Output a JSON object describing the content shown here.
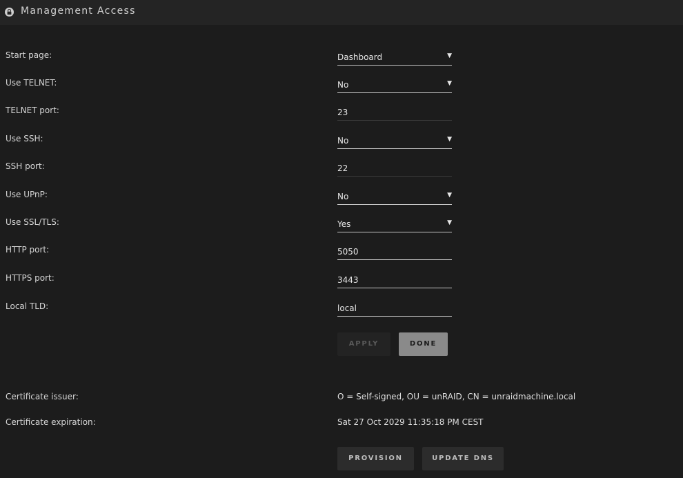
{
  "header": {
    "title": "Management Access",
    "icon": "lock-icon"
  },
  "settings": [
    {
      "label": "Start page:",
      "value": "Dashboard",
      "kind": "select"
    },
    {
      "label": "Use TELNET:",
      "value": "No",
      "kind": "select"
    },
    {
      "label": "TELNET port:",
      "value": "23",
      "kind": "input"
    },
    {
      "label": "Use SSH:",
      "value": "No",
      "kind": "select"
    },
    {
      "label": "SSH port:",
      "value": "22",
      "kind": "input"
    },
    {
      "label": "Use UPnP:",
      "value": "No",
      "kind": "select"
    },
    {
      "label": "Use SSL/TLS:",
      "value": "Yes",
      "kind": "select"
    },
    {
      "label": "HTTP port:",
      "value": "5050",
      "kind": "input"
    },
    {
      "label": "HTTPS port:",
      "value": "3443",
      "kind": "input"
    },
    {
      "label": "Local TLD:",
      "value": "local",
      "kind": "input"
    }
  ],
  "buttons": {
    "apply": "Apply",
    "done": "Done",
    "provision": "Provision",
    "update_dns": "Update DNS"
  },
  "certificate": {
    "issuer_label": "Certificate issuer:",
    "issuer_value": "O = Self-signed, OU = unRAID, CN = unraidmachine.local",
    "expiration_label": "Certificate expiration:",
    "expiration_value": "Sat 27 Oct 2029 11:35:18 PM CEST"
  },
  "caret_glyph": "▼"
}
